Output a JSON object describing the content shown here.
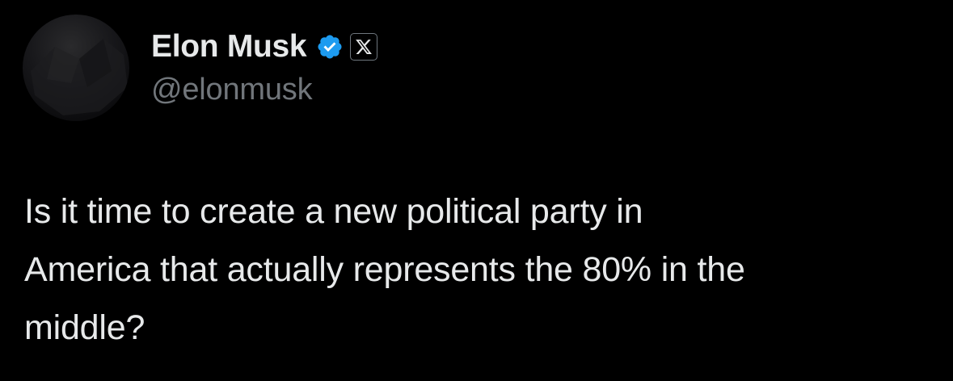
{
  "author": {
    "display_name": "Elon Musk",
    "handle": "@elonmusk",
    "verified_badge_icon": "verified-badge-icon",
    "affiliation_badge_icon": "x-logo-icon",
    "verified_color": "#1d9bf0"
  },
  "tweet": {
    "text": "Is it time to create a new political party in\nAmerica that actually represents the 80% in the\nmiddle?"
  },
  "colors": {
    "background": "#000000",
    "text_primary": "#e7e9ea",
    "text_secondary": "#71767b"
  }
}
